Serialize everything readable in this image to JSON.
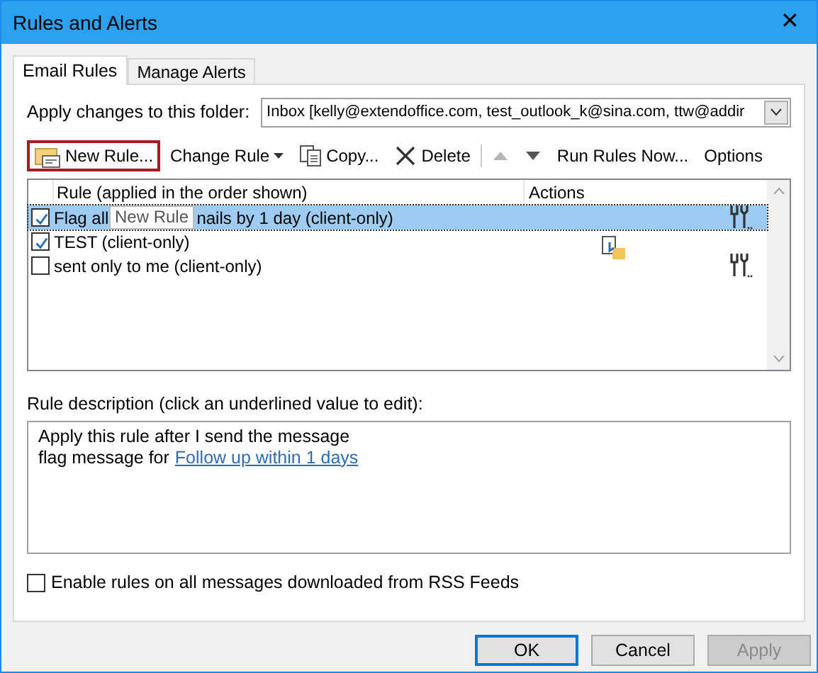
{
  "window": {
    "title": "Rules and Alerts",
    "close": "✕"
  },
  "tabs": [
    {
      "label": "Email Rules",
      "selected": true
    },
    {
      "label": "Manage Alerts",
      "selected": false
    }
  ],
  "folder": {
    "label": "Apply changes to this folder:",
    "value": "Inbox [kelly@extendoffice.com, test_outlook_k@sina.com, ttw@addir"
  },
  "toolbar": [
    {
      "kind": "new",
      "label": "New Rule...",
      "focused": true,
      "disabled": false
    },
    {
      "kind": "change",
      "label": "Change Rule",
      "focused": false,
      "disabled": false
    },
    {
      "kind": "copy",
      "label": "Copy...",
      "focused": false,
      "disabled": false
    },
    {
      "kind": "delete",
      "label": "Delete",
      "focused": false,
      "disabled": false
    },
    {
      "kind": "up",
      "focused": false,
      "disabled": true
    },
    {
      "kind": "down",
      "focused": false,
      "disabled": false
    },
    {
      "kind": "text",
      "label": "Run Rules Now...",
      "focused": false,
      "disabled": false
    },
    {
      "kind": "text",
      "label": "Options",
      "focused": false,
      "disabled": false
    }
  ],
  "rules": {
    "columns": [
      "Rule (applied in the order shown)",
      "Actions"
    ],
    "rows": [
      {
        "text_parts": [
          "Flag all",
          "nails by 1 day  (client-only)"
        ],
        "checked": true,
        "selected": true,
        "kind": "tools"
      },
      {
        "text_parts": [
          "TEST  (client-only)"
        ],
        "checked": true,
        "selected": false,
        "kind": "move"
      },
      {
        "text_parts": [
          "sent only to me  (client-only)"
        ],
        "checked": false,
        "selected": false,
        "kind": "tools"
      }
    ]
  },
  "tooltip": "New Rule",
  "description": {
    "label": "Rule description (click an underlined value to edit):",
    "lines": [
      {
        "text": "Apply this rule after I send the message"
      },
      {
        "text": "flag message for",
        "link": "Follow up within 1 days"
      }
    ]
  },
  "rss": {
    "label": "Enable rules on all messages downloaded from RSS Feeds",
    "checked": false
  },
  "buttons": [
    {
      "label": "OK",
      "default": true,
      "disabled": false
    },
    {
      "label": "Cancel",
      "default": false,
      "disabled": false
    },
    {
      "label": "Apply",
      "default": false,
      "disabled": true
    }
  ]
}
